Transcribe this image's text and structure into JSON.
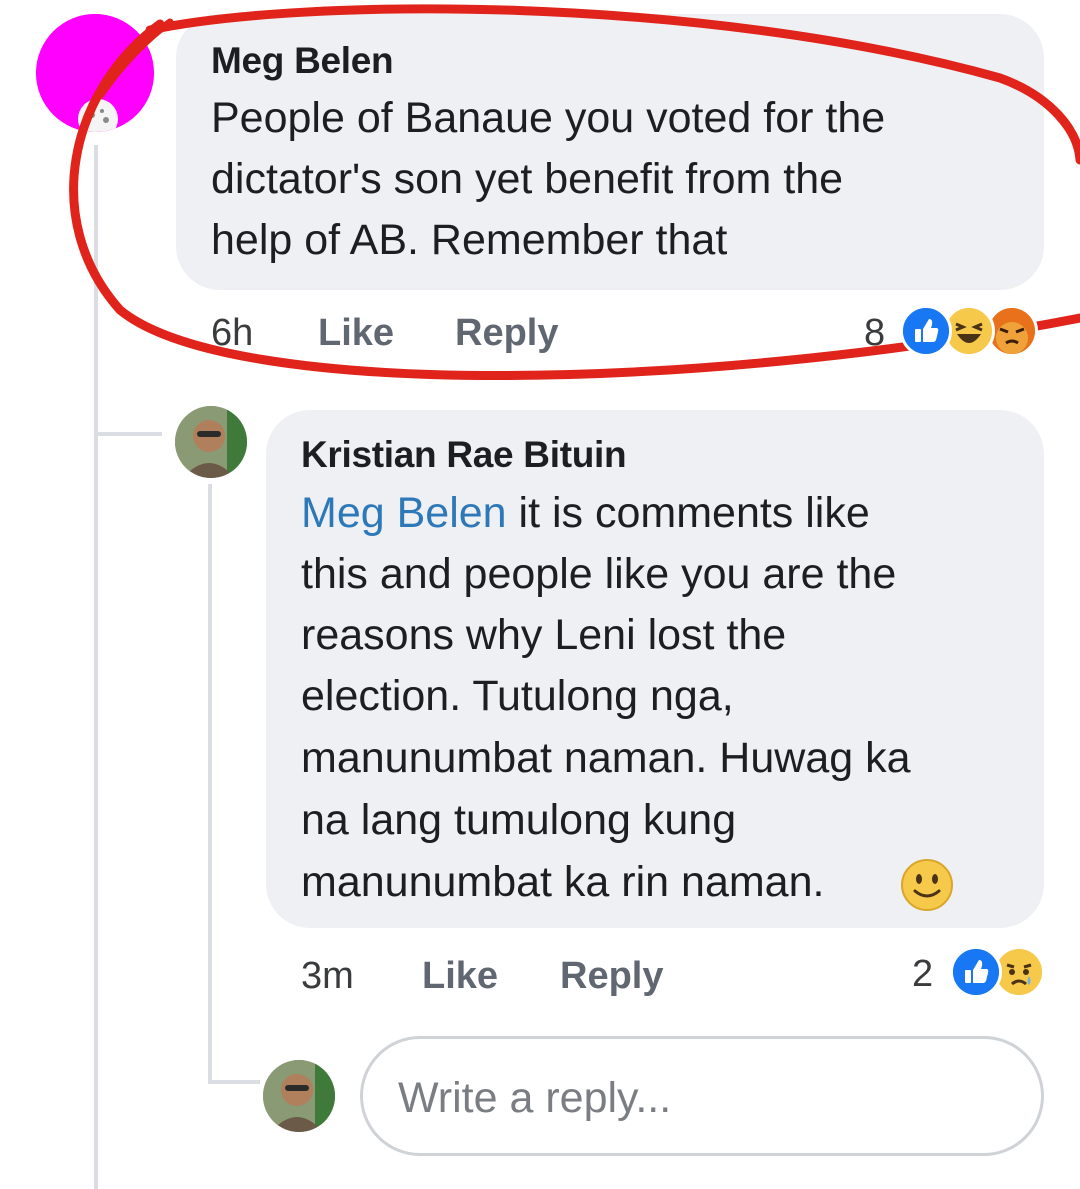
{
  "comments": [
    {
      "author": "Meg Belen",
      "text_lines": [
        "People of Banaue you voted for the",
        "dictator's son yet benefit from the",
        "help of AB. Remember that"
      ],
      "time": "6h",
      "like_label": "Like",
      "reply_label": "Reply",
      "reaction_count": "8",
      "reactions": [
        "like-icon",
        "haha-icon",
        "angry-icon"
      ]
    },
    {
      "author": "Kristian Rae Bituin",
      "mention": "Meg Belen",
      "text_lines": [
        " it is comments like",
        "this and people like you are the",
        "reasons why Leni lost the",
        "election. Tutulong nga,",
        "manunumbat naman. Huwag ka",
        "na lang tumulong kung",
        "manunumbat ka rin naman."
      ],
      "emoji": "slightly-smiling-face",
      "time": "3m",
      "like_label": "Like",
      "reply_label": "Reply",
      "reaction_count": "2",
      "reactions": [
        "like-icon",
        "sad-icon"
      ]
    }
  ],
  "reply_box": {
    "placeholder": "Write a reply..."
  },
  "colors": {
    "bubble": "#eff0f3",
    "mention": "#2d78b8",
    "annotation": "#e0241b",
    "like_blue": "#1877f2",
    "first_avatar": "#ff00ff"
  }
}
